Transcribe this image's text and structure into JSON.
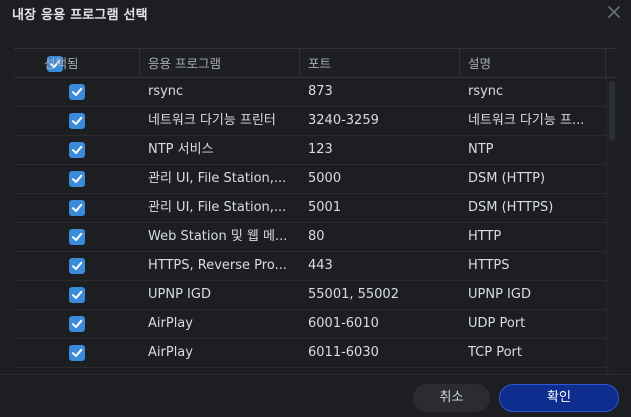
{
  "dialog": {
    "title": "내장 응용 프로그램 선택"
  },
  "table": {
    "columns": [
      "선택됨",
      "응용 프로그램",
      "포트",
      "설명"
    ],
    "rows": [
      {
        "checked": true,
        "app": "rsync",
        "port": "873",
        "desc": "rsync"
      },
      {
        "checked": true,
        "app": "네트워크 다기능 프린터",
        "port": "3240-3259",
        "desc": "네트워크 다기능 프..."
      },
      {
        "checked": true,
        "app": "NTP 서비스",
        "port": "123",
        "desc": "NTP"
      },
      {
        "checked": true,
        "app": "관리 UI, File Station,...",
        "port": "5000",
        "desc": "DSM (HTTP)"
      },
      {
        "checked": true,
        "app": "관리 UI, File Station,...",
        "port": "5001",
        "desc": "DSM (HTTPS)"
      },
      {
        "checked": true,
        "app": "Web Station 및 웹 메...",
        "port": "80",
        "desc": "HTTP"
      },
      {
        "checked": true,
        "app": "HTTPS, Reverse Pro...",
        "port": "443",
        "desc": "HTTPS"
      },
      {
        "checked": true,
        "app": "UPNP IGD",
        "port": "55001, 55002",
        "desc": "UPNP IGD"
      },
      {
        "checked": true,
        "app": "AirPlay",
        "port": "6001-6010",
        "desc": "UDP Port"
      },
      {
        "checked": true,
        "app": "AirPlay",
        "port": "6011-6030",
        "desc": "TCP Port"
      }
    ]
  },
  "footer": {
    "cancel_label": "취소",
    "ok_label": "확인"
  },
  "colors": {
    "checkbox": "#3a8bd9",
    "primary_button": "#0e2d8f"
  }
}
